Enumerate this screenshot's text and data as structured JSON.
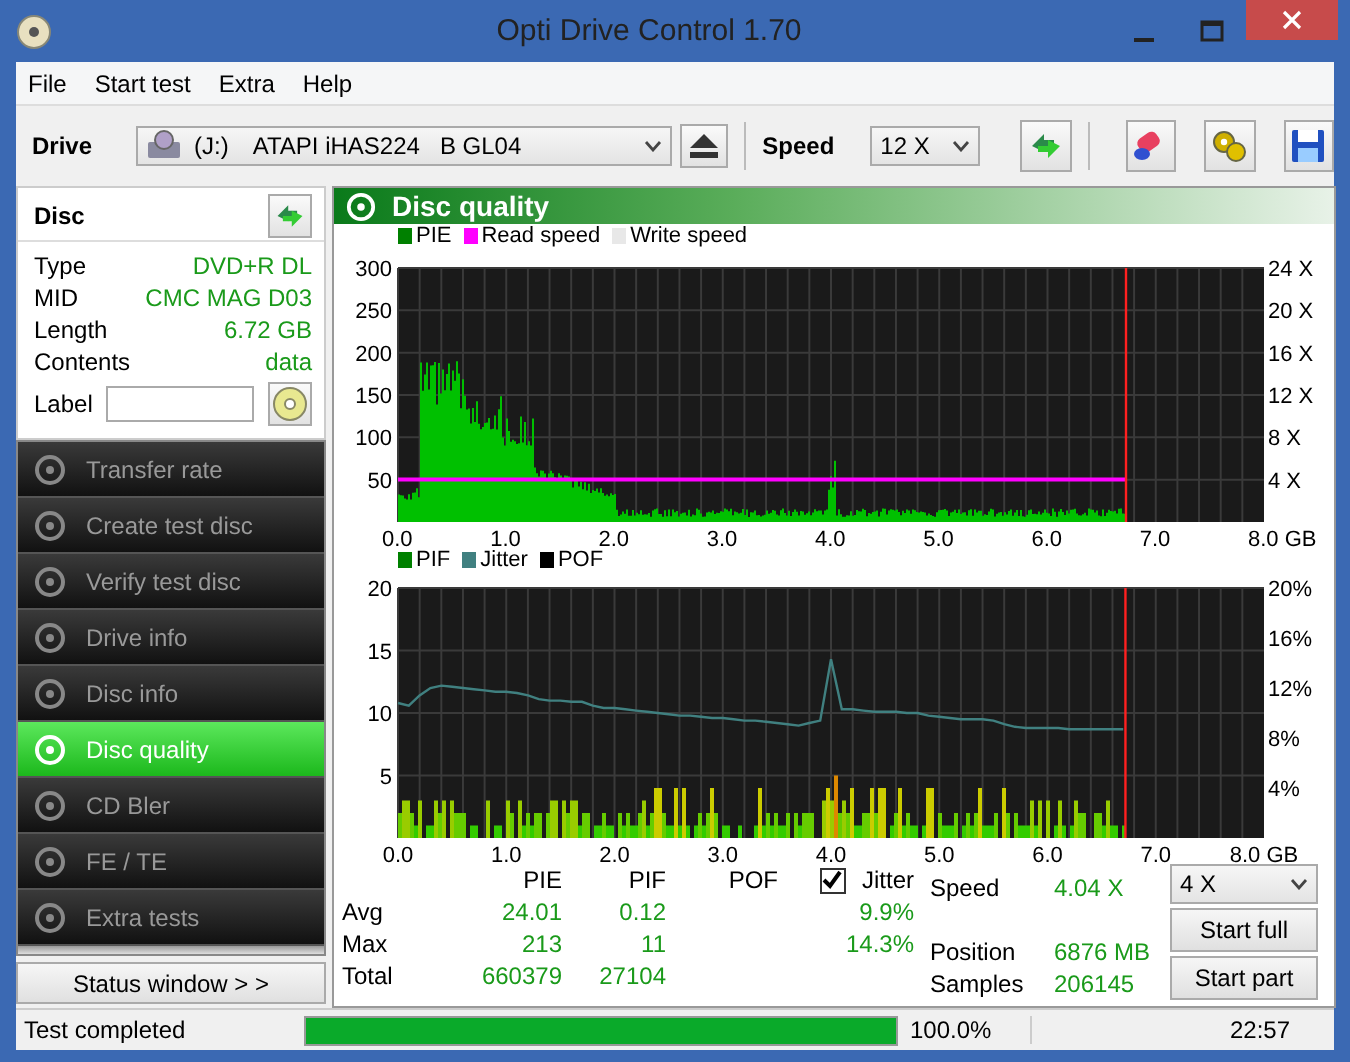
{
  "window": {
    "title": "Opti Drive Control 1.70"
  },
  "menu": [
    "File",
    "Start test",
    "Extra",
    "Help"
  ],
  "toolbar": {
    "drive_label": "Drive",
    "drive_letter": "(J:)",
    "drive_name": "ATAPI iHAS224   B GL04",
    "speed_label": "Speed",
    "speed": "12 X"
  },
  "disc": {
    "title": "Disc",
    "label_field": "Label",
    "fields": [
      {
        "label": "Type",
        "value": "DVD+R DL"
      },
      {
        "label": "MID",
        "value": "CMC MAG D03"
      },
      {
        "label": "Length",
        "value": "6.72 GB"
      },
      {
        "label": "Contents",
        "value": "data"
      }
    ]
  },
  "nav": [
    {
      "label": "Transfer rate",
      "selected": false
    },
    {
      "label": "Create test disc",
      "selected": false
    },
    {
      "label": "Verify test disc",
      "selected": false
    },
    {
      "label": "Drive info",
      "selected": false
    },
    {
      "label": "Disc info",
      "selected": false
    },
    {
      "label": "Disc quality",
      "selected": true
    },
    {
      "label": "CD Bler",
      "selected": false
    },
    {
      "label": "FE / TE",
      "selected": false
    },
    {
      "label": "Extra tests",
      "selected": false
    }
  ],
  "status_button": "Status window > >",
  "panel": {
    "title": "Disc quality"
  },
  "chart_pie": {
    "legend": [
      {
        "label": "PIE",
        "color": "#008000"
      },
      {
        "label": "Read speed",
        "color": "#ff00ff"
      },
      {
        "label": "Write speed",
        "color": "#e8e8e8"
      }
    ],
    "yticks": [
      "300",
      "250",
      "200",
      "150",
      "100",
      "50"
    ],
    "y2ticks": [
      "24 X",
      "20 X",
      "16 X",
      "12 X",
      "8 X",
      "4 X"
    ],
    "xticks": [
      "0.0",
      "1.0",
      "2.0",
      "3.0",
      "4.0",
      "5.0",
      "6.0",
      "7.0",
      "8.0 GB"
    ]
  },
  "chart_pif": {
    "chart_data": {
      "type": "line",
      "xlim": [
        0,
        8
      ],
      "ylim": [
        0,
        20
      ],
      "grid": true,
      "ref_lines": [
        {
          "axis": "x",
          "value": 6.72,
          "color": "#ff2020"
        }
      ],
      "xticks": [
        {
          "value": 0,
          "label": "0.0"
        },
        {
          "value": 1,
          "label": "1.0"
        },
        {
          "value": 2,
          "label": "2.0"
        },
        {
          "value": 3,
          "label": "3.0"
        },
        {
          "value": 4,
          "label": "4.0"
        },
        {
          "value": 5,
          "label": "5.0"
        },
        {
          "value": 6,
          "label": "6.0"
        },
        {
          "value": 7,
          "label": "7.0"
        },
        {
          "value": 8,
          "label": "8.0 GB"
        }
      ],
      "yticks": [
        {
          "value": 20,
          "label": "20%"
        },
        {
          "value": 16,
          "label": "16%"
        },
        {
          "value": 12,
          "label": "12%"
        },
        {
          "value": 8,
          "label": "8%"
        },
        {
          "value": 4,
          "label": "4%"
        }
      ],
      "x": [
        0.0,
        0.1,
        0.2,
        0.3,
        0.4,
        0.5,
        0.6,
        0.7,
        0.8,
        0.9,
        1.0,
        1.1,
        1.2,
        1.3,
        1.4,
        1.5,
        1.6,
        1.7,
        1.8,
        1.9,
        2.0,
        2.1,
        2.2,
        2.3,
        2.4,
        2.5,
        2.6,
        2.7,
        2.8,
        2.9,
        3.0,
        3.1,
        3.2,
        3.3,
        3.4,
        3.5,
        3.6,
        3.7,
        3.8,
        3.9,
        4.0,
        4.1,
        4.2,
        4.3,
        4.4,
        4.5,
        4.6,
        4.7,
        4.8,
        4.9,
        5.0,
        5.1,
        5.2,
        5.3,
        5.4,
        5.5,
        5.6,
        5.7,
        5.8,
        5.9,
        6.0,
        6.1,
        6.2,
        6.3,
        6.4,
        6.5,
        6.6,
        6.7
      ],
      "series": [
        {
          "name": "Jitter",
          "color": "#408080",
          "values": [
            10.8,
            10.6,
            11.4,
            12.0,
            12.2,
            12.1,
            12.0,
            11.9,
            11.8,
            11.7,
            11.7,
            11.6,
            11.4,
            11.1,
            11.0,
            11.0,
            10.9,
            10.9,
            10.6,
            10.4,
            10.4,
            10.3,
            10.2,
            10.1,
            10.0,
            9.9,
            9.8,
            9.8,
            9.7,
            9.6,
            9.6,
            9.5,
            9.4,
            9.4,
            9.3,
            9.2,
            9.1,
            9.0,
            9.2,
            9.4,
            14.3,
            10.3,
            10.3,
            10.2,
            10.1,
            10.1,
            10.1,
            10.0,
            10.0,
            9.8,
            9.7,
            9.6,
            9.5,
            9.5,
            9.5,
            9.4,
            9.1,
            8.9,
            8.8,
            8.8,
            8.8,
            8.8,
            8.7,
            8.7,
            8.7,
            8.7,
            8.7,
            8.7
          ]
        }
      ]
    },
    "legend": [
      {
        "label": "PIF",
        "color": "#008000"
      },
      {
        "label": "POF",
        "color": "#000000"
      }
    ],
    "yticks": [
      "20",
      "15",
      "10",
      "5"
    ]
  },
  "stats": {
    "columns": [
      "PIE",
      "PIF",
      "POF",
      "Jitter"
    ],
    "jitter_checked": true,
    "rows": [
      {
        "label": "Avg",
        "pie": "24.01",
        "pif": "0.12",
        "jitter": "9.9%"
      },
      {
        "label": "Max",
        "pie": "213",
        "pif": "11",
        "jitter": "14.3%"
      },
      {
        "label": "Total",
        "pie": "660379",
        "pif": "27104"
      }
    ]
  },
  "info": [
    {
      "label": "Speed",
      "value": "4.04 X"
    },
    {
      "label": "Position",
      "value": "6876 MB"
    },
    {
      "label": "Samples",
      "value": "206145"
    }
  ],
  "speed_select": "4 X",
  "buttons": [
    "Start full",
    "Start part"
  ],
  "status_bar": {
    "text": "Test completed",
    "level": 1.0,
    "percent": "100.0%",
    "time": "22:57"
  }
}
